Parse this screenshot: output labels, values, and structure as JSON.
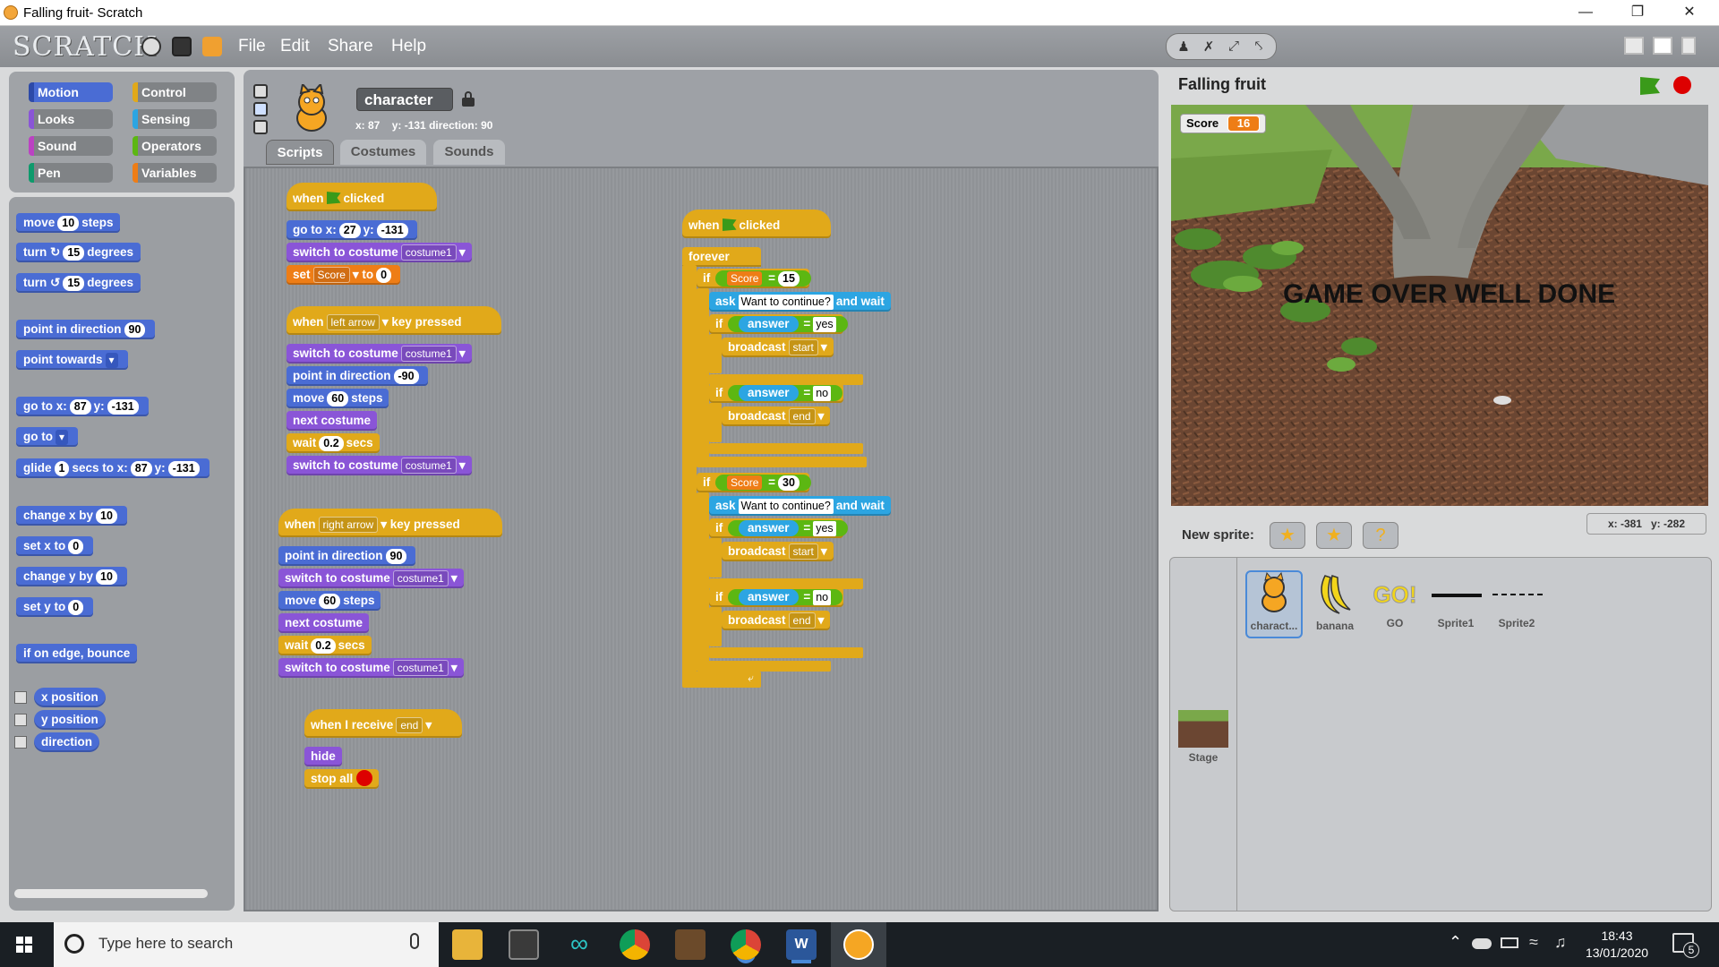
{
  "window": {
    "title": "Falling fruit- Scratch"
  },
  "menubar": {
    "logo": "SCRATCH",
    "items": [
      "File",
      "Edit",
      "Share",
      "Help"
    ]
  },
  "categories": [
    {
      "label": "Motion",
      "color": "#4a6cd4"
    },
    {
      "label": "Control",
      "color": "#e1a91a"
    },
    {
      "label": "Looks",
      "color": "#8a55d7"
    },
    {
      "label": "Sensing",
      "color": "#2ca5e2"
    },
    {
      "label": "Sound",
      "color": "#bb42c3"
    },
    {
      "label": "Operators",
      "color": "#5cb712"
    },
    {
      "label": "Pen",
      "color": "#0e9a6c"
    },
    {
      "label": "Variables",
      "color": "#ee7d16"
    }
  ],
  "palette": {
    "move": {
      "a": "move",
      "n": "10",
      "b": "steps"
    },
    "turn_cw": {
      "a": "turn",
      "n": "15",
      "b": "degrees"
    },
    "turn_ccw": {
      "a": "turn",
      "n": "15",
      "b": "degrees"
    },
    "point_dir": {
      "a": "point in direction",
      "n": "90"
    },
    "point_towards": {
      "a": "point towards"
    },
    "goto_xy": {
      "a": "go to x:",
      "x": "87",
      "ylabel": "y:",
      "y": "-131"
    },
    "goto": {
      "a": "go to"
    },
    "glide": {
      "a": "glide",
      "n": "1",
      "b": "secs to x:",
      "x": "87",
      "ylabel": "y:",
      "y": "-131"
    },
    "change_x": {
      "a": "change x by",
      "n": "10"
    },
    "set_x": {
      "a": "set x to",
      "n": "0"
    },
    "change_y": {
      "a": "change y by",
      "n": "10"
    },
    "set_y": {
      "a": "set y to",
      "n": "0"
    },
    "bounce": {
      "a": "if on edge, bounce"
    },
    "reporters": [
      "x position",
      "y position",
      "direction"
    ]
  },
  "sprite": {
    "name": "character",
    "x": "x: 87",
    "y": "y: -131",
    "direction": "direction: 90"
  },
  "tabs": [
    "Scripts",
    "Costumes",
    "Sounds"
  ],
  "script1": {
    "when": "when",
    "clicked": "clicked",
    "goto": "go to x:",
    "x": "27",
    "ylabel": "y:",
    "y": "-131",
    "switch": "switch to costume",
    "costume": "costume1",
    "set": "set",
    "var": "Score",
    "to": "to",
    "val": "0"
  },
  "script2": {
    "when": "when",
    "key": "left arrow",
    "pressed": "key pressed",
    "switch": "switch to costume",
    "costume": "costume1",
    "point": "point in direction",
    "dir": "-90",
    "move": "move",
    "steps_n": "60",
    "steps": "steps",
    "next": "next costume",
    "wait": "wait",
    "secs_n": "0.2",
    "secs": "secs"
  },
  "script3": {
    "when": "when",
    "key": "right arrow",
    "pressed": "key pressed",
    "point": "point in direction",
    "dir": "90",
    "switch": "switch to costume",
    "costume": "costume1",
    "move": "move",
    "steps_n": "60",
    "steps": "steps",
    "next": "next costume",
    "wait": "wait",
    "secs_n": "0.2",
    "secs": "secs"
  },
  "script4": {
    "when": "when I receive",
    "msg": "end",
    "hide": "hide",
    "stop": "stop all"
  },
  "script5": {
    "when": "when",
    "clicked": "clicked",
    "forever": "forever",
    "if": "if",
    "score": "Score",
    "eq": "=",
    "v1": "15",
    "v2": "30",
    "ask": "ask",
    "question": "Want to continue?",
    "andwait": "and wait",
    "answer": "answer",
    "yes": "yes",
    "no": "no",
    "broadcast": "broadcast",
    "start": "start",
    "end": "end"
  },
  "stage": {
    "title": "Falling fruit",
    "score_label": "Score",
    "score_value": "16",
    "message": "GAME OVER WELL DONE",
    "mouse_x": "x: -381",
    "mouse_y": "y: -282"
  },
  "new_sprite": {
    "label": "New sprite:"
  },
  "sprites": [
    "charact...",
    "banana",
    "GO",
    "Sprite1",
    "Sprite2"
  ],
  "go_text": "GO!",
  "stage_thumb": "Stage",
  "taskbar": {
    "search_placeholder": "Type here to search",
    "time": "18:43",
    "date": "13/01/2020",
    "notifications": "5"
  }
}
